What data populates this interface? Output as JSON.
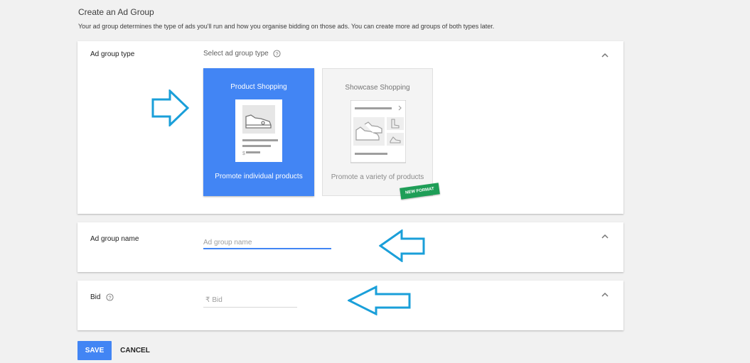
{
  "header": {
    "title": "Create an Ad Group",
    "subtitle": "Your ad group determines the type of ads you'll run and how you organise bidding on those ads. You can create more ad groups of both types later."
  },
  "ad_group_type": {
    "label": "Ad group type",
    "select_label": "Select ad group type",
    "options": [
      {
        "title": "Product Shopping",
        "description": "Promote individual products",
        "selected": true
      },
      {
        "title": "Showcase Shopping",
        "description": "Promote a variety of products",
        "selected": false,
        "badge": "NEW FORMAT"
      }
    ]
  },
  "ad_group_name": {
    "label": "Ad group name",
    "placeholder": "Ad group name",
    "value": ""
  },
  "bid": {
    "label": "Bid",
    "currency_symbol": "₹",
    "placeholder": "Bid",
    "value": ""
  },
  "actions": {
    "save_label": "SAVE",
    "cancel_label": "CANCEL"
  },
  "colors": {
    "accent": "#4285f4",
    "badge": "#1e9e57",
    "annotation_arrow": "#1a9fd9",
    "background": "#f1f1f1"
  },
  "icons": [
    "chevron-up-icon",
    "help-icon",
    "sneaker-icon",
    "boot-icon",
    "heel-icon",
    "arrow-right-annotation",
    "arrow-left-annotation"
  ]
}
